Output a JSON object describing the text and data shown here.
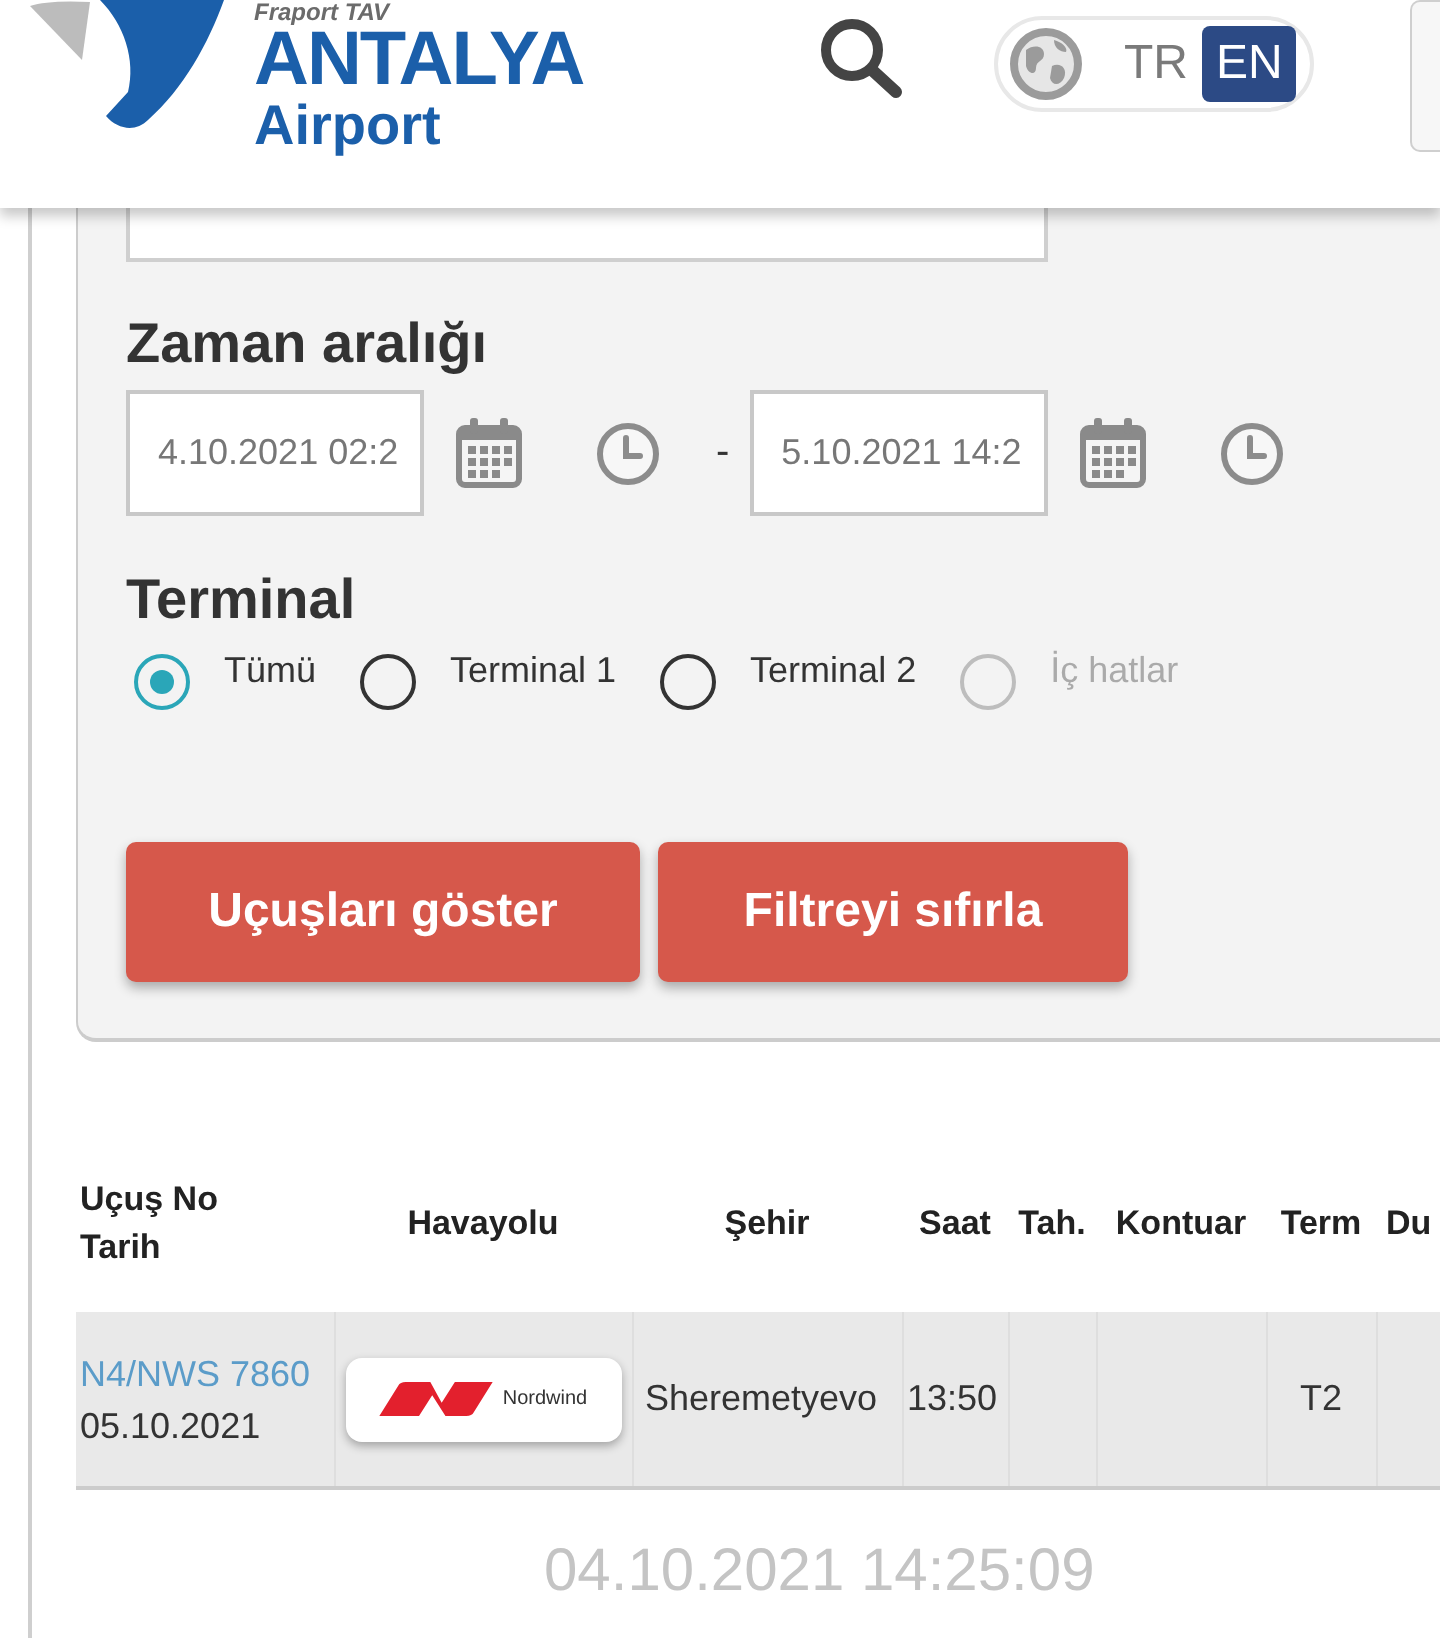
{
  "header": {
    "logo": {
      "tagline": "Fraport TAV",
      "name": "ANTALYA",
      "subtitle": "Airport"
    },
    "languages": [
      {
        "label": "TR",
        "selected": false
      },
      {
        "label": "EN",
        "selected": true
      }
    ]
  },
  "filter": {
    "time_range": {
      "title": "Zaman aralığı",
      "from": "4.10.2021 02:2",
      "separator": "-",
      "to": "5.10.2021 14:2"
    },
    "terminal": {
      "title": "Terminal",
      "options": [
        {
          "label": "Tümü",
          "selected": true,
          "disabled": false
        },
        {
          "label": "Terminal 1",
          "selected": false,
          "disabled": false
        },
        {
          "label": "Terminal 2",
          "selected": false,
          "disabled": false
        },
        {
          "label": "İç hatlar",
          "selected": false,
          "disabled": true
        }
      ]
    },
    "buttons": [
      "Uçuşları göster",
      "Filtreyi sıfırla"
    ]
  },
  "table": {
    "columns": [
      {
        "lines": [
          "Uçuş No",
          "Tarih"
        ]
      },
      {
        "lines": [
          "Havayolu"
        ]
      },
      {
        "lines": [
          "Şehir"
        ]
      },
      {
        "lines": [
          "Saat"
        ]
      },
      {
        "lines": [
          "Tah."
        ]
      },
      {
        "lines": [
          "Kontuar"
        ]
      },
      {
        "lines": [
          "Term"
        ]
      },
      {
        "lines": [
          "Du"
        ]
      }
    ],
    "rows": [
      {
        "flight_no": "N4/NWS 7860",
        "date": "05.10.2021",
        "airline": "Nordwind",
        "city": "Sheremetyevo",
        "time": "13:50",
        "terminal": "T2"
      }
    ]
  },
  "updated_at": "04.10.2021 14:25:09"
}
